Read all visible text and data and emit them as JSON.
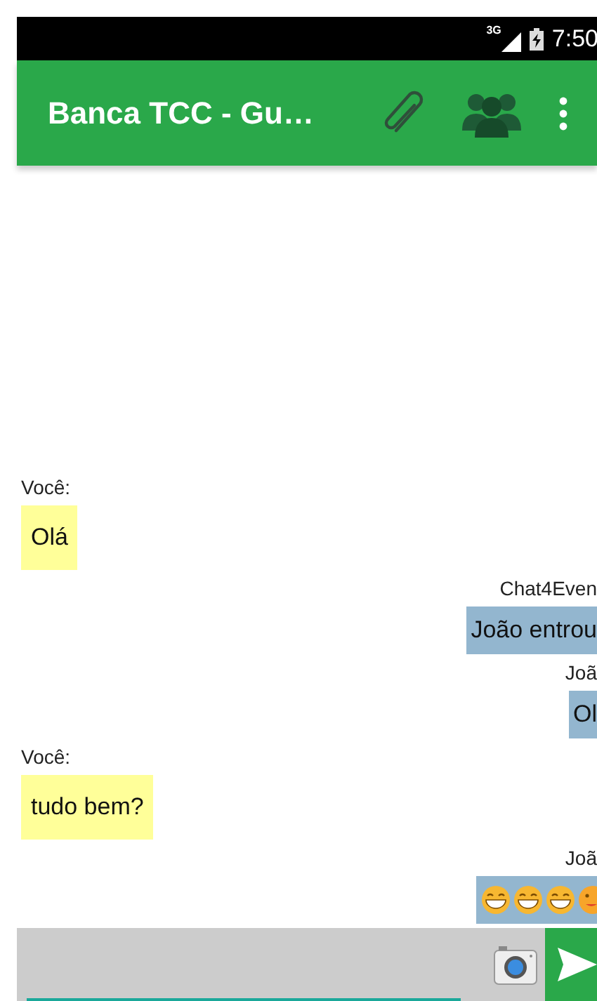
{
  "status_bar": {
    "network": "3G",
    "time": "7:50"
  },
  "app_bar": {
    "title": "Banca TCC - Gu…"
  },
  "messages": [
    {
      "sender": "Você:",
      "outgoing": true,
      "kind": "text",
      "text": "Olá"
    },
    {
      "sender": "Chat4Even",
      "outgoing": false,
      "kind": "text",
      "text": "João entrou"
    },
    {
      "sender": "Joã",
      "outgoing": false,
      "kind": "text",
      "text": "Ol"
    },
    {
      "sender": "Você:",
      "outgoing": true,
      "kind": "text",
      "text": "tudo bem?"
    },
    {
      "sender": "Joã",
      "outgoing": false,
      "kind": "emoji"
    }
  ]
}
